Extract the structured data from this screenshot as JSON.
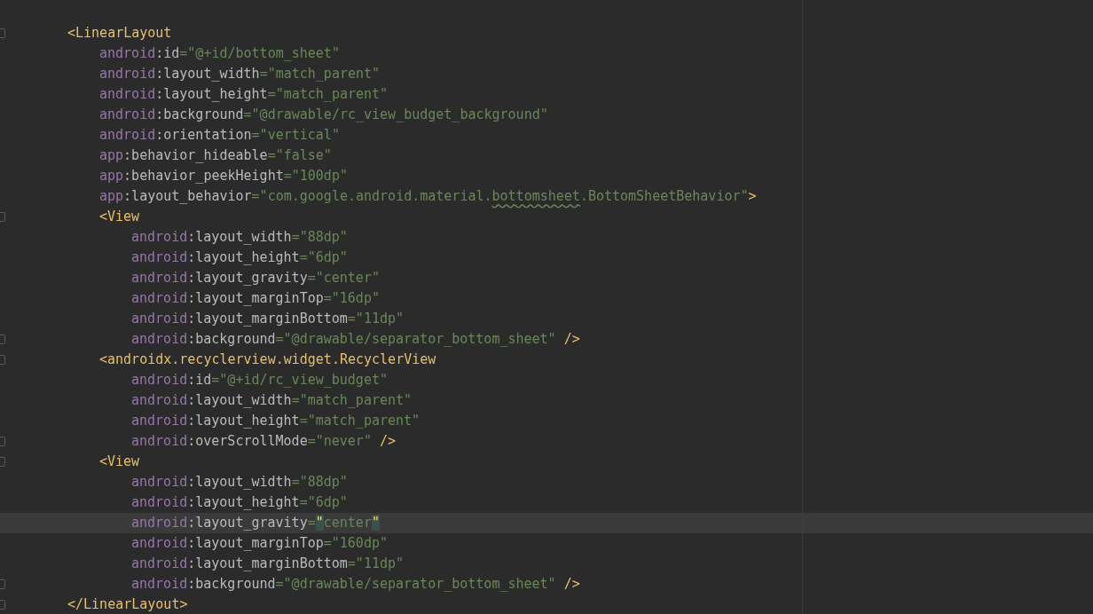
{
  "editor": {
    "lines": [
      {
        "fold": true,
        "current": false,
        "tokens": [
          {
            "kind": "tag",
            "text": "<LinearLayout"
          }
        ],
        "children": [
          {
            "fold": false,
            "current": false,
            "tokens": [
              {
                "kind": "ns",
                "text": "android"
              },
              {
                "kind": "attr",
                "text": ":id"
              },
              {
                "kind": "value",
                "text": "=\"@+id/bottom_sheet\""
              }
            ]
          },
          {
            "fold": false,
            "current": false,
            "tokens": [
              {
                "kind": "ns",
                "text": "android"
              },
              {
                "kind": "attr",
                "text": ":layout_width"
              },
              {
                "kind": "value",
                "text": "=\"match_parent\""
              }
            ]
          },
          {
            "fold": false,
            "current": false,
            "tokens": [
              {
                "kind": "ns",
                "text": "android"
              },
              {
                "kind": "attr",
                "text": ":layout_height"
              },
              {
                "kind": "value",
                "text": "=\"match_parent\""
              }
            ]
          },
          {
            "fold": false,
            "current": false,
            "tokens": [
              {
                "kind": "ns",
                "text": "android"
              },
              {
                "kind": "attr",
                "text": ":background"
              },
              {
                "kind": "value",
                "text": "=\"@drawable/rc_view_budget_background\""
              }
            ]
          },
          {
            "fold": false,
            "current": false,
            "tokens": [
              {
                "kind": "ns",
                "text": "android"
              },
              {
                "kind": "attr",
                "text": ":orientation"
              },
              {
                "kind": "value",
                "text": "=\"vertical\""
              }
            ]
          },
          {
            "fold": false,
            "current": false,
            "tokens": [
              {
                "kind": "ns",
                "text": "app"
              },
              {
                "kind": "attr",
                "text": ":behavior_hideable"
              },
              {
                "kind": "value",
                "text": "=\"false\""
              }
            ]
          },
          {
            "fold": false,
            "current": false,
            "tokens": [
              {
                "kind": "ns",
                "text": "app"
              },
              {
                "kind": "attr",
                "text": ":behavior_peekHeight"
              },
              {
                "kind": "value",
                "text": "=\"100dp\""
              }
            ]
          },
          {
            "fold": false,
            "current": false,
            "tokens": [
              {
                "kind": "ns",
                "text": "app"
              },
              {
                "kind": "attr",
                "text": ":layout_behavior"
              },
              {
                "kind": "value",
                "text": "=\"com.google.android.material."
              },
              {
                "kind": "typo",
                "text": "bottomsheet"
              },
              {
                "kind": "value",
                "text": ".BottomSheetBehavior\""
              },
              {
                "kind": "tag",
                "text": ">"
              }
            ]
          },
          {
            "fold": true,
            "current": false,
            "tokens": [
              {
                "kind": "tag",
                "text": "<View"
              }
            ],
            "children": [
              {
                "fold": false,
                "current": false,
                "tokens": [
                  {
                    "kind": "ns",
                    "text": "android"
                  },
                  {
                    "kind": "attr",
                    "text": ":layout_width"
                  },
                  {
                    "kind": "value",
                    "text": "=\"88dp\""
                  }
                ]
              },
              {
                "fold": false,
                "current": false,
                "tokens": [
                  {
                    "kind": "ns",
                    "text": "android"
                  },
                  {
                    "kind": "attr",
                    "text": ":layout_height"
                  },
                  {
                    "kind": "value",
                    "text": "=\"6dp\""
                  }
                ]
              },
              {
                "fold": false,
                "current": false,
                "tokens": [
                  {
                    "kind": "ns",
                    "text": "android"
                  },
                  {
                    "kind": "attr",
                    "text": ":layout_gravity"
                  },
                  {
                    "kind": "value",
                    "text": "=\"center\""
                  }
                ]
              },
              {
                "fold": false,
                "current": false,
                "tokens": [
                  {
                    "kind": "ns",
                    "text": "android"
                  },
                  {
                    "kind": "attr",
                    "text": ":layout_marginTop"
                  },
                  {
                    "kind": "value",
                    "text": "=\"16dp\""
                  }
                ]
              },
              {
                "fold": false,
                "current": false,
                "tokens": [
                  {
                    "kind": "ns",
                    "text": "android"
                  },
                  {
                    "kind": "attr",
                    "text": ":layout_marginBottom"
                  },
                  {
                    "kind": "value",
                    "text": "=\"11dp\""
                  }
                ]
              },
              {
                "fold": true,
                "current": false,
                "tokens": [
                  {
                    "kind": "ns",
                    "text": "android"
                  },
                  {
                    "kind": "attr",
                    "text": ":background"
                  },
                  {
                    "kind": "value",
                    "text": "=\"@drawable/separator_bottom_sheet\""
                  },
                  {
                    "kind": "tag",
                    "text": " />"
                  }
                ]
              }
            ]
          },
          {
            "fold": true,
            "current": false,
            "tokens": [
              {
                "kind": "tag",
                "text": "<androidx.recyclerview.widget.RecyclerView"
              }
            ],
            "children": [
              {
                "fold": false,
                "current": false,
                "tokens": [
                  {
                    "kind": "ns",
                    "text": "android"
                  },
                  {
                    "kind": "attr",
                    "text": ":id"
                  },
                  {
                    "kind": "value",
                    "text": "=\"@+id/rc_view_budget\""
                  }
                ]
              },
              {
                "fold": false,
                "current": false,
                "tokens": [
                  {
                    "kind": "ns",
                    "text": "android"
                  },
                  {
                    "kind": "attr",
                    "text": ":layout_width"
                  },
                  {
                    "kind": "value",
                    "text": "=\"match_parent\""
                  }
                ]
              },
              {
                "fold": false,
                "current": false,
                "tokens": [
                  {
                    "kind": "ns",
                    "text": "android"
                  },
                  {
                    "kind": "attr",
                    "text": ":layout_height"
                  },
                  {
                    "kind": "value",
                    "text": "=\"match_parent\""
                  }
                ]
              },
              {
                "fold": true,
                "current": false,
                "tokens": [
                  {
                    "kind": "ns",
                    "text": "android"
                  },
                  {
                    "kind": "attr",
                    "text": ":overScrollMode"
                  },
                  {
                    "kind": "value",
                    "text": "=\"never\""
                  },
                  {
                    "kind": "tag",
                    "text": " />"
                  }
                ]
              }
            ]
          },
          {
            "fold": true,
            "current": false,
            "tokens": [
              {
                "kind": "tag",
                "text": "<View"
              }
            ],
            "children": [
              {
                "fold": false,
                "current": false,
                "tokens": [
                  {
                    "kind": "ns",
                    "text": "android"
                  },
                  {
                    "kind": "attr",
                    "text": ":layout_width"
                  },
                  {
                    "kind": "value",
                    "text": "=\"88dp\""
                  }
                ]
              },
              {
                "fold": false,
                "current": false,
                "tokens": [
                  {
                    "kind": "ns",
                    "text": "android"
                  },
                  {
                    "kind": "attr",
                    "text": ":layout_height"
                  },
                  {
                    "kind": "value",
                    "text": "=\"6dp\""
                  }
                ]
              },
              {
                "fold": false,
                "current": true,
                "tokens": [
                  {
                    "kind": "ns",
                    "text": "android"
                  },
                  {
                    "kind": "attr",
                    "text": ":layout_gravity"
                  },
                  {
                    "kind": "value",
                    "text": "="
                  },
                  {
                    "kind": "match",
                    "text": "\""
                  },
                  {
                    "kind": "value",
                    "text": "center"
                  },
                  {
                    "kind": "match",
                    "text": "\""
                  }
                ]
              },
              {
                "fold": false,
                "current": false,
                "tokens": [
                  {
                    "kind": "ns",
                    "text": "android"
                  },
                  {
                    "kind": "attr",
                    "text": ":layout_marginTop"
                  },
                  {
                    "kind": "value",
                    "text": "=\"160dp\""
                  }
                ]
              },
              {
                "fold": false,
                "current": false,
                "tokens": [
                  {
                    "kind": "ns",
                    "text": "android"
                  },
                  {
                    "kind": "attr",
                    "text": ":layout_marginBottom"
                  },
                  {
                    "kind": "value",
                    "text": "=\"11dp\""
                  }
                ]
              },
              {
                "fold": true,
                "current": false,
                "tokens": [
                  {
                    "kind": "ns",
                    "text": "android"
                  },
                  {
                    "kind": "attr",
                    "text": ":background"
                  },
                  {
                    "kind": "value",
                    "text": "=\"@drawable/separator_bottom_sheet\""
                  },
                  {
                    "kind": "tag",
                    "text": " />"
                  }
                ]
              }
            ]
          }
        ]
      },
      {
        "fold": true,
        "current": false,
        "tokens": [
          {
            "kind": "tag",
            "text": "</LinearLayout>"
          }
        ]
      }
    ]
  }
}
